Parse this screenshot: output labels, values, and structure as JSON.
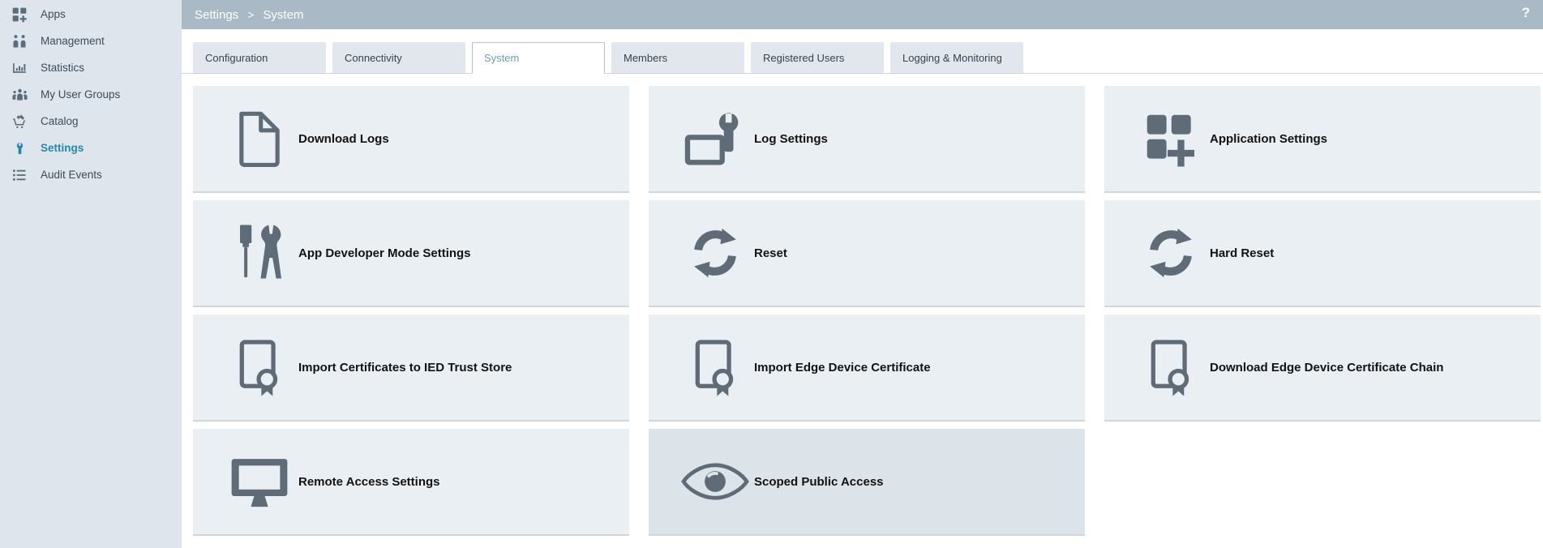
{
  "breadcrumb": {
    "path": [
      "Settings",
      "System"
    ],
    "separator": ">"
  },
  "help": {
    "label": "?"
  },
  "sidebar": {
    "items": [
      {
        "label": "Apps",
        "icon": "apps-icon"
      },
      {
        "label": "Management",
        "icon": "management-icon"
      },
      {
        "label": "Statistics",
        "icon": "statistics-icon"
      },
      {
        "label": "My User Groups",
        "icon": "user-groups-icon"
      },
      {
        "label": "Catalog",
        "icon": "catalog-icon"
      },
      {
        "label": "Settings",
        "icon": "wrench-icon",
        "active": true
      },
      {
        "label": "Audit Events",
        "icon": "list-icon"
      }
    ]
  },
  "tabs": {
    "items": [
      {
        "label": "Configuration",
        "active": false
      },
      {
        "label": "Connectivity",
        "active": false
      },
      {
        "label": "System",
        "active": true
      },
      {
        "label": "Members",
        "active": false
      },
      {
        "label": "Registered Users",
        "active": false
      },
      {
        "label": "Logging & Monitoring",
        "active": false
      }
    ]
  },
  "cards": {
    "items": [
      {
        "label": "Download Logs",
        "icon": "document-icon",
        "highlighted": false
      },
      {
        "label": "Log Settings",
        "icon": "screen-wrench-icon",
        "highlighted": false
      },
      {
        "label": "Application Settings",
        "icon": "apps-plus-icon",
        "highlighted": false
      },
      {
        "label": "App Developer Mode Settings",
        "icon": "tools-icon",
        "highlighted": false
      },
      {
        "label": "Reset",
        "icon": "reset-icon",
        "highlighted": false
      },
      {
        "label": "Hard Reset",
        "icon": "reset-icon",
        "highlighted": false
      },
      {
        "label": "Import Certificates to IED Trust Store",
        "icon": "certificate-icon",
        "highlighted": false
      },
      {
        "label": "Import Edge Device Certificate",
        "icon": "certificate-icon",
        "highlighted": false
      },
      {
        "label": "Download Edge Device Certificate Chain",
        "icon": "certificate-icon",
        "highlighted": false
      },
      {
        "label": "Remote Access Settings",
        "icon": "monitor-icon",
        "highlighted": false
      },
      {
        "label": "Scoped Public Access",
        "icon": "eye-icon",
        "highlighted": true
      }
    ]
  },
  "colors": {
    "accent": "#2289ae",
    "topbar_bg": "#a9bac6",
    "sidebar_bg": "#dfe5ed",
    "card_bg": "#eaeff3",
    "card_highlight_bg": "#dce3e9",
    "icon_gray": "#5f6b76"
  }
}
